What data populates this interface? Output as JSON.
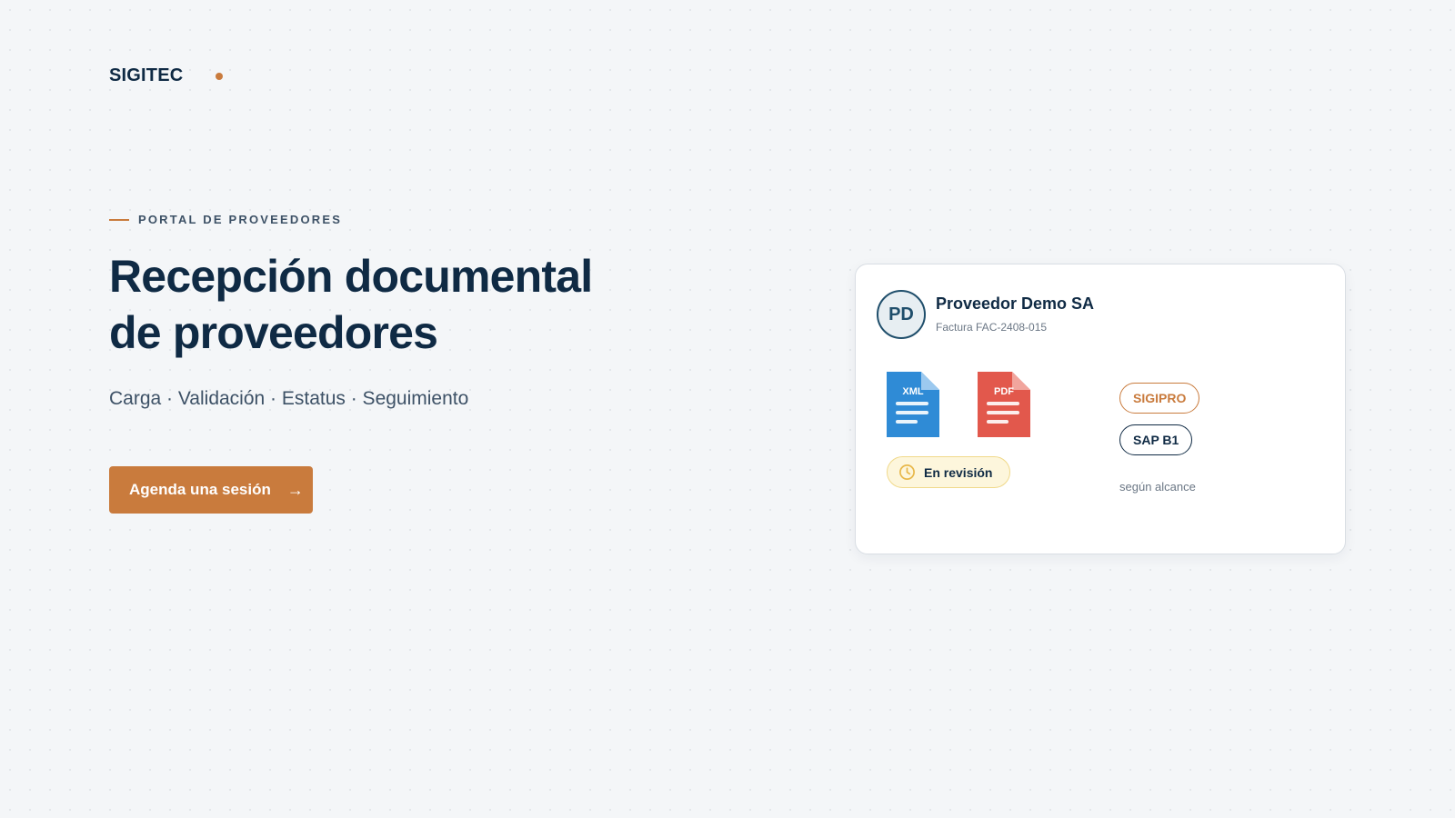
{
  "brand": {
    "name": "SIGITEC",
    "accent_color": "#c97b3d"
  },
  "hero": {
    "eyebrow": "PORTAL DE PROVEEDORES",
    "title_line1": "Recepción documental",
    "title_line2": "de proveedores",
    "subtitle": "Carga · Validación · Estatus · Seguimiento",
    "cta_label": "Agenda una sesión",
    "cta_arrow": "→"
  },
  "card": {
    "avatar_initials": "PD",
    "supplier_name": "Proveedor Demo SA",
    "invoice_ref": "Factura FAC-2408-015",
    "files": [
      {
        "label": "XML",
        "icon": "xml-file-icon",
        "color": "#2f8bd6"
      },
      {
        "label": "PDF",
        "icon": "pdf-file-icon",
        "color": "#e2584c"
      }
    ],
    "status": {
      "label": "En revisión",
      "icon": "clock-icon",
      "color": "#e8b84a"
    },
    "tags": [
      "SIGIPRO",
      "SAP B1"
    ],
    "scope_note": "según alcance"
  },
  "colors": {
    "navy": "#0f2a44",
    "accent": "#c97b3d",
    "background": "#f4f6f8"
  }
}
